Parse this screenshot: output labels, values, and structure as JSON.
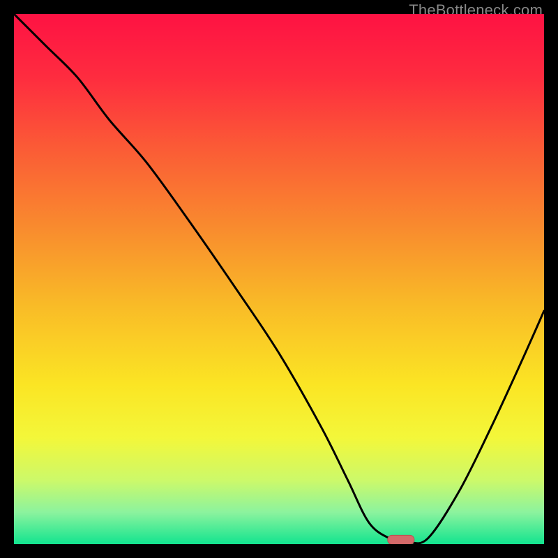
{
  "watermark": "TheBottleneck.com",
  "colors": {
    "frame": "#000000",
    "curve": "#000000",
    "marker_fill": "#d46a6a",
    "marker_stroke": "#b94e4e",
    "gradient_stops": [
      {
        "offset": 0.0,
        "color": "#fe1243"
      },
      {
        "offset": 0.12,
        "color": "#fe2c3f"
      },
      {
        "offset": 0.25,
        "color": "#fb5a36"
      },
      {
        "offset": 0.4,
        "color": "#f98a2e"
      },
      {
        "offset": 0.55,
        "color": "#f9bb27"
      },
      {
        "offset": 0.7,
        "color": "#fbe524"
      },
      {
        "offset": 0.8,
        "color": "#f3f73a"
      },
      {
        "offset": 0.88,
        "color": "#ccf96a"
      },
      {
        "offset": 0.94,
        "color": "#8cf39e"
      },
      {
        "offset": 1.0,
        "color": "#12e48f"
      }
    ]
  },
  "chart_data": {
    "type": "line",
    "title": "",
    "xlabel": "",
    "ylabel": "",
    "xlim": [
      0,
      100
    ],
    "ylim": [
      0,
      100
    ],
    "note": "Axes unlabeled; a V-shaped bottleneck curve over a red→green vertical gradient. Values estimated from pixel position: x is percent across width, y (0=bottom, 100=top) is percent of height.",
    "series": [
      {
        "name": "bottleneck-curve",
        "x": [
          0,
          6,
          12,
          18,
          25,
          33,
          42,
          50,
          58,
          63,
          67,
          71,
          74,
          78,
          84,
          90,
          96,
          100
        ],
        "y": [
          100,
          94,
          88,
          80,
          72,
          61,
          48,
          36,
          22,
          12,
          4,
          1,
          0.5,
          1,
          10,
          22,
          35,
          44
        ]
      }
    ],
    "marker": {
      "x": 73,
      "y": 0.8,
      "shape": "pill"
    }
  }
}
